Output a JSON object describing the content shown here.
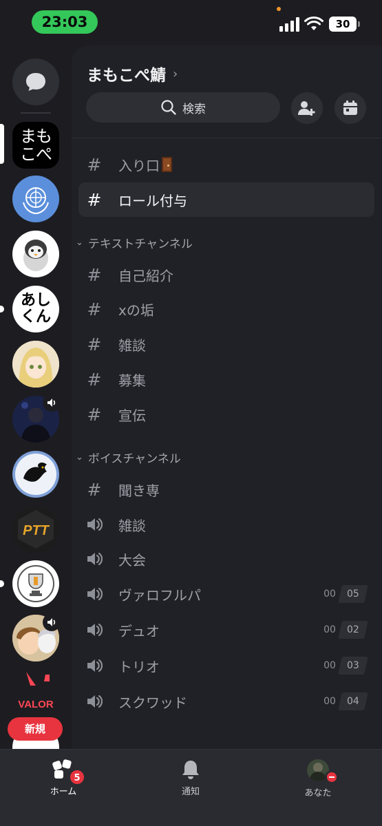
{
  "status_bar": {
    "time": "23:03",
    "battery": "30"
  },
  "server": {
    "name": "まもこぺ鯖"
  },
  "search": {
    "label": "検索"
  },
  "rail": {
    "servers": [
      {
        "name": "まもこぺ",
        "text": "まもこぺ"
      },
      {
        "name": "un-emblem"
      },
      {
        "name": "penguin"
      },
      {
        "name": "あしくん",
        "text": "あしくん"
      },
      {
        "name": "blonde-girl"
      },
      {
        "name": "dark-character"
      },
      {
        "name": "dragon"
      },
      {
        "name": "PTT",
        "text": "PTT"
      },
      {
        "name": "trophy"
      },
      {
        "name": "anime-boys"
      },
      {
        "name": "valorant",
        "text": "VALOR"
      }
    ],
    "new_label": "新規"
  },
  "channels": {
    "top": [
      {
        "name": "入り口",
        "type": "text"
      },
      {
        "name": "ロール付与",
        "type": "text",
        "active": true
      }
    ],
    "categories": [
      {
        "name": "テキストチャンネル",
        "channels": [
          {
            "name": "自己紹介",
            "type": "text"
          },
          {
            "name": "xの垢",
            "type": "text"
          },
          {
            "name": "雑談",
            "type": "text"
          },
          {
            "name": "募集",
            "type": "text"
          },
          {
            "name": "宣伝",
            "type": "text"
          }
        ]
      },
      {
        "name": "ボイスチャンネル",
        "channels": [
          {
            "name": "聞き専",
            "type": "text"
          },
          {
            "name": "雑談",
            "type": "voice"
          },
          {
            "name": "大会",
            "type": "voice"
          },
          {
            "name": "ヴァロフルパ",
            "type": "voice",
            "count": "00",
            "limit": "05"
          },
          {
            "name": "デュオ",
            "type": "voice",
            "count": "00",
            "limit": "02"
          },
          {
            "name": "トリオ",
            "type": "voice",
            "count": "00",
            "limit": "03"
          },
          {
            "name": "スクワッド",
            "type": "voice",
            "count": "00",
            "limit": "04"
          }
        ]
      }
    ]
  },
  "tabs": {
    "home": {
      "label": "ホーム",
      "badge": "5"
    },
    "notifications": {
      "label": "通知"
    },
    "you": {
      "label": "あなた"
    }
  },
  "colors": {
    "accent_red": "#e8343f",
    "status_green": "#34c759"
  }
}
